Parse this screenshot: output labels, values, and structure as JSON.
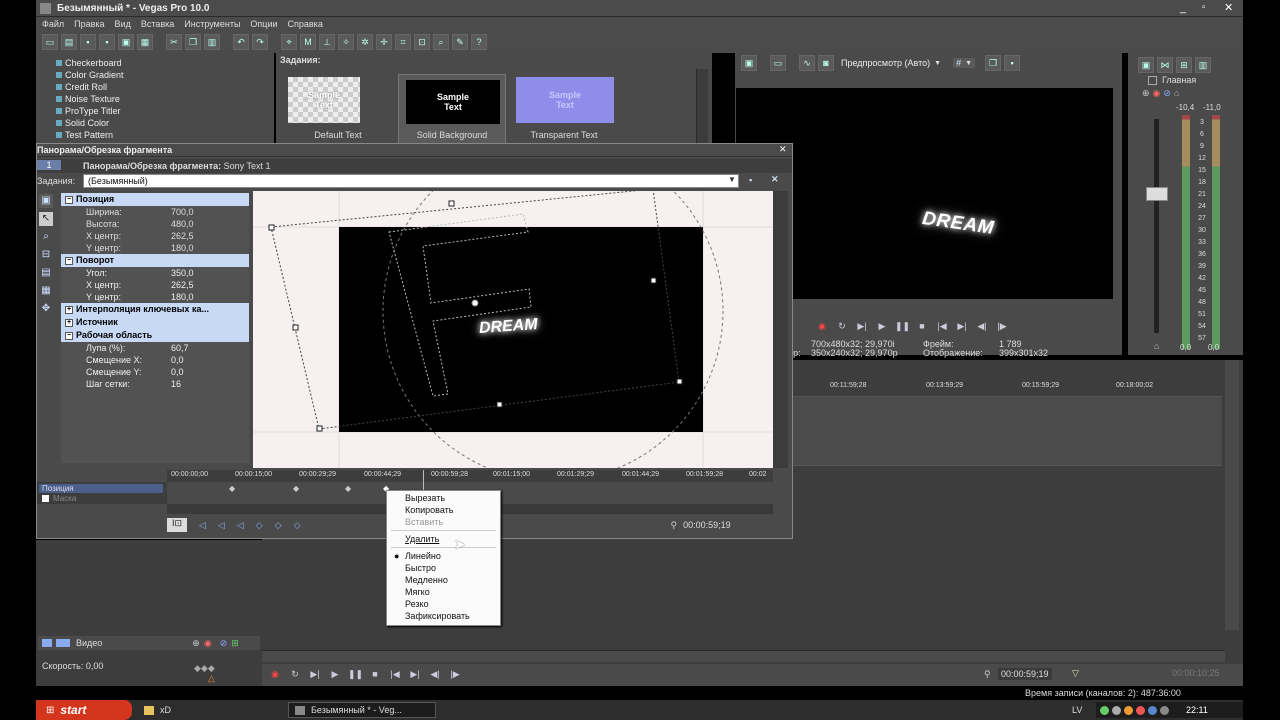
{
  "app": {
    "title": "Безымянный * - Vegas Pro 10.0",
    "menu": [
      "Файл",
      "Правка",
      "Вид",
      "Вставка",
      "Инструменты",
      "Опции",
      "Справка"
    ]
  },
  "media_list": {
    "items": [
      "Checkerboard",
      "Color Gradient",
      "Credit Roll",
      "Noise Texture",
      "ProType Titler",
      "Solid Color",
      "Test Pattern"
    ]
  },
  "presets": {
    "label": "Задания:",
    "items": [
      {
        "name": "Default Text",
        "thumb": "Sample Text"
      },
      {
        "name": "Solid Background",
        "thumb": "Sample Text"
      },
      {
        "name": "Transparent Text",
        "thumb": "Sample Text"
      }
    ]
  },
  "preview": {
    "mode": "Предпросмотр (Авто)",
    "grid": "#",
    "text": "DREAM",
    "info_project": "700x480x32; 29,970i",
    "info_frame_label": "Фрейм:",
    "info_frame_value": "1 789",
    "info_preview_prefix": "тр:",
    "info_preview": "350x240x32; 29,970p",
    "info_display_label": "Отображение:",
    "info_display": "399x301x32"
  },
  "mixer": {
    "title": "Главная",
    "peak_left": "-10,4",
    "peak_right": "-11,0",
    "scale": [
      "3",
      "6",
      "9",
      "12",
      "15",
      "18",
      "21",
      "24",
      "27",
      "30",
      "33",
      "36",
      "39",
      "42",
      "45",
      "48",
      "51",
      "54",
      "57"
    ],
    "val_left": "0,0",
    "val_right": "0,0"
  },
  "pan_dialog": {
    "title": "Панорама/Обрезка фрагмента",
    "track_num": "1",
    "subtitle_bold": "Панорама/Обрезка фрагмента:",
    "subtitle_rest": "Sony Text 1",
    "preset_label": "Задания:",
    "preset_value": "(Безымянный)",
    "canvas_text": "DREAM",
    "sections": [
      {
        "title": "Позиция",
        "rows": [
          {
            "k": "Ширина:",
            "v": "700,0"
          },
          {
            "k": "Высота:",
            "v": "480,0"
          },
          {
            "k": "X центр:",
            "v": "262,5"
          },
          {
            "k": "Y центр:",
            "v": "180,0"
          }
        ]
      },
      {
        "title": "Поворот",
        "rows": [
          {
            "k": "Угол:",
            "v": "350,0"
          },
          {
            "k": "X центр:",
            "v": "262,5"
          },
          {
            "k": "Y центр:",
            "v": "180,0"
          }
        ]
      },
      {
        "title": "Интерполяция ключевых ка...",
        "rows": []
      },
      {
        "title": "Источник",
        "rows": []
      },
      {
        "title": "Рабочая область",
        "rows": [
          {
            "k": "Лупа (%):",
            "v": "60,7"
          },
          {
            "k": "Смещение X:",
            "v": "0,0"
          },
          {
            "k": "Смещение Y:",
            "v": "0,0"
          },
          {
            "k": "Шаг сетки:",
            "v": "16"
          }
        ]
      }
    ],
    "timeline_ticks": [
      "00:00:00;00",
      "00:00:15;00",
      "00:00:29;29",
      "00:00:44;29",
      "00:00:59;28",
      "00:01:15;00",
      "00:01:29;29",
      "00:01:44;29",
      "00:01:59;28",
      "00:02"
    ],
    "track_pos": "Позиция",
    "track_mask": "Маска",
    "time": "00:00:59;19"
  },
  "context_menu": {
    "items": [
      {
        "label": "Вырезать",
        "disabled": false,
        "bullet": false
      },
      {
        "label": "Копировать",
        "disabled": false,
        "bullet": false
      },
      {
        "label": "Вставить",
        "disabled": true,
        "bullet": false
      },
      {
        "label": "Удалить",
        "disabled": false,
        "bullet": false
      },
      {
        "label": "Линейно",
        "disabled": false,
        "bullet": true
      },
      {
        "label": "Быстро",
        "disabled": false,
        "bullet": false
      },
      {
        "label": "Медленно",
        "disabled": false,
        "bullet": false
      },
      {
        "label": "Мягко",
        "disabled": false,
        "bullet": false
      },
      {
        "label": "Резко",
        "disabled": false,
        "bullet": false
      },
      {
        "label": "Зафиксировать",
        "disabled": false,
        "bullet": false
      }
    ]
  },
  "main_timeline": {
    "ticks": [
      "00:11:59;28",
      "00:13:59;29",
      "00:15:59;29",
      "00:18:00;02"
    ],
    "track_label": "Видео",
    "speed": "Скорость: 0,00",
    "time": "00:00:59;19",
    "end_time": "00:00:10;25",
    "status": "Время записи (каналов: 2): 487:36:00"
  },
  "taskbar": {
    "start": "start",
    "items": [
      "xD",
      "Безымянный * - Veg..."
    ],
    "lang": "LV",
    "clock": "22:11"
  }
}
